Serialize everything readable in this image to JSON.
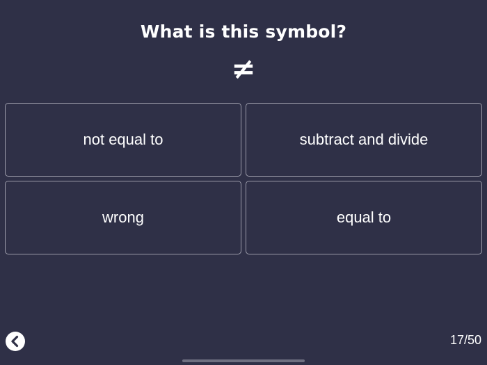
{
  "quiz": {
    "question": "What is this symbol?",
    "symbol": "≠",
    "answers": [
      {
        "label": "not equal to"
      },
      {
        "label": "subtract and divide"
      },
      {
        "label": "wrong"
      },
      {
        "label": "equal to"
      }
    ],
    "progress": "17/50"
  },
  "icons": {
    "back": "chevron-left-icon"
  },
  "colors": {
    "background": "#2f3047",
    "text": "#ffffff",
    "border": "#9c9caa"
  }
}
